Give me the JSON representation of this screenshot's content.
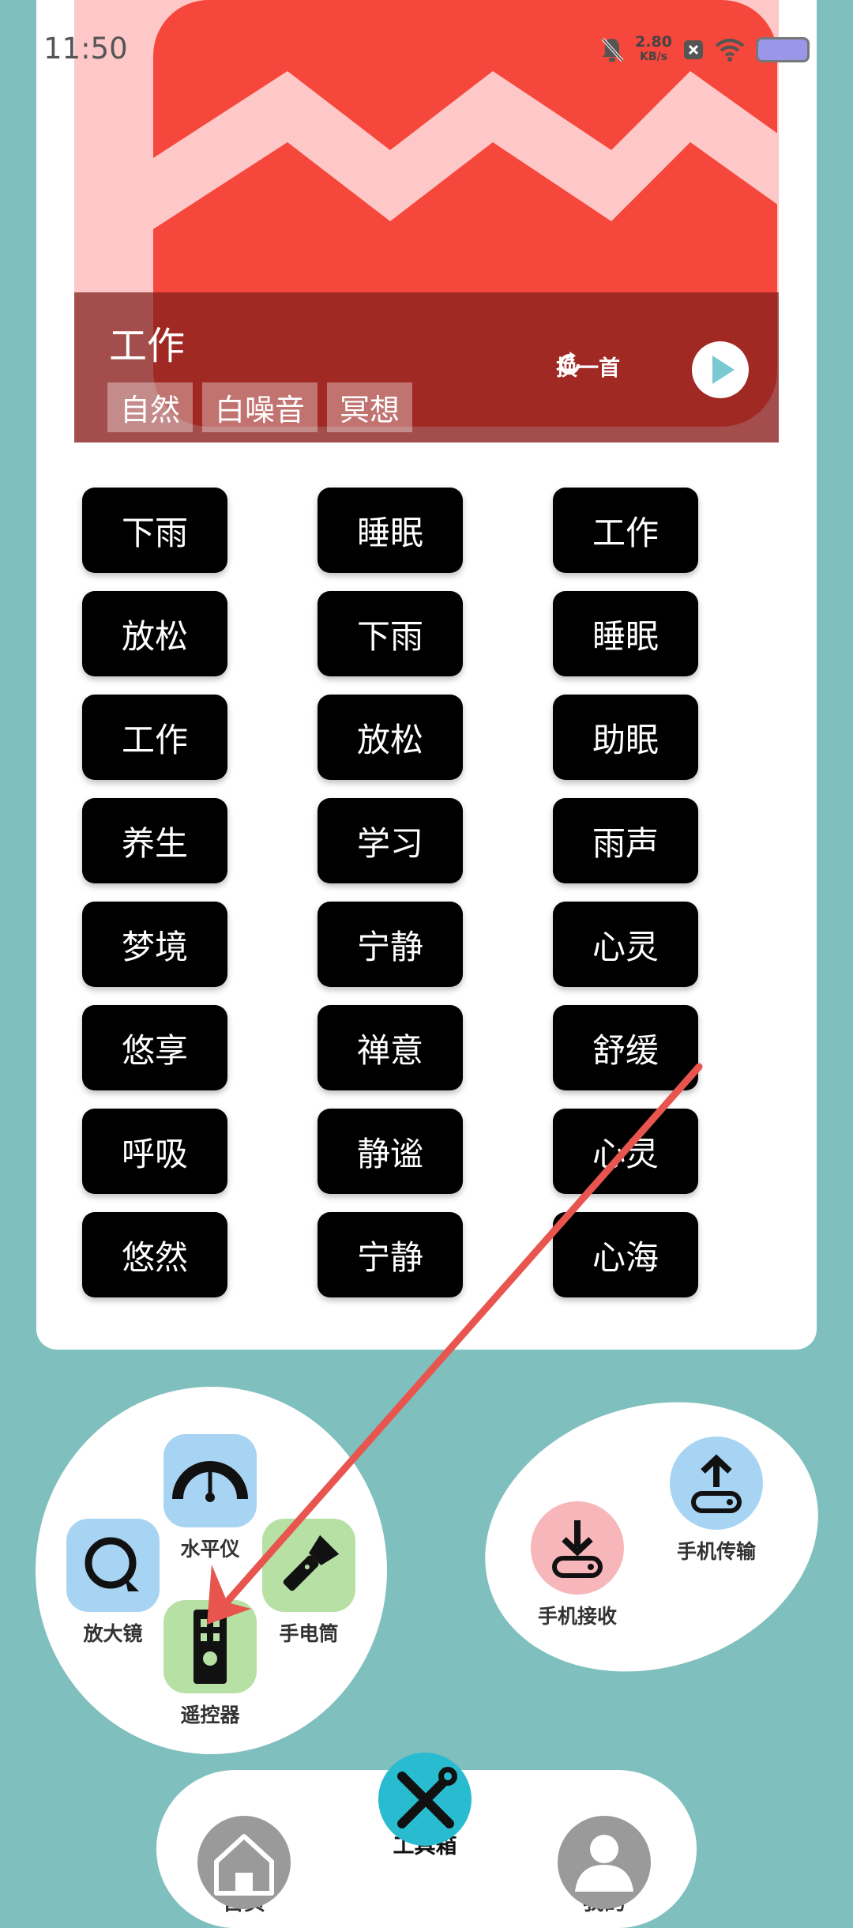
{
  "status_bar": {
    "time": "11:50",
    "net_speed_value": "2.80",
    "net_speed_unit": "KB/s"
  },
  "hero": {
    "title": "工作",
    "tags": [
      "自然",
      "白噪音",
      "冥想"
    ],
    "refresh_label": "换一首"
  },
  "chips": [
    [
      "下雨",
      "睡眠",
      "工作"
    ],
    [
      "放松",
      "下雨",
      "睡眠"
    ],
    [
      "工作",
      "放松",
      "助眠"
    ],
    [
      "养生",
      "学习",
      "雨声"
    ],
    [
      "梦境",
      "宁静",
      "心灵"
    ],
    [
      "悠享",
      "禅意",
      "舒缓"
    ],
    [
      "呼吸",
      "静谧",
      "心灵"
    ],
    [
      "悠然",
      "宁静",
      "心海"
    ]
  ],
  "tools_left": {
    "level": "水平仪",
    "magnifier": "放大镜",
    "flashlight": "手电筒",
    "remote": "遥控器"
  },
  "tools_right": {
    "receive": "手机接收",
    "transfer": "手机传输"
  },
  "nav": {
    "home": "首页",
    "toolbox": "工具箱",
    "mine": "我的"
  },
  "colors": {
    "background": "#7fbfbd",
    "hero_red": "#f5473b",
    "hero_pink": "#ffc8c8",
    "annotation_arrow": "#e8554f"
  }
}
